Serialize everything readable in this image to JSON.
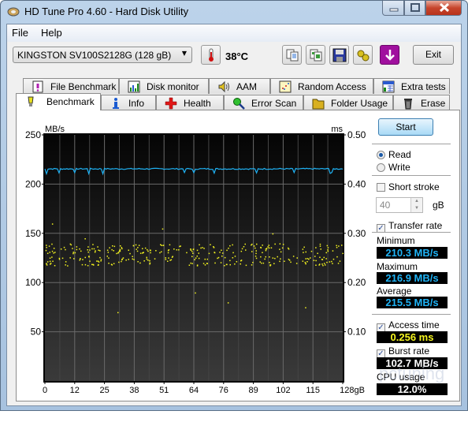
{
  "window": {
    "title": "HD Tune Pro 4.60 - Hard Disk Utility",
    "controls": {
      "minimize": "minimize-icon",
      "maximize": "maximize-icon",
      "close": "close-icon"
    }
  },
  "menu": [
    {
      "label": "File"
    },
    {
      "label": "Help"
    }
  ],
  "toolbar": {
    "drive": "KINGSTON SV100S2128G (128 gB)",
    "temperature": "38°C",
    "buttons": [
      "copy-text-icon",
      "copy-screenshot-icon",
      "save-icon",
      "options-icon",
      "download-icon"
    ],
    "exit_label": "Exit"
  },
  "tabs_top": [
    {
      "label": "File Benchmark",
      "icon": "file-benchmark-icon"
    },
    {
      "label": "Disk monitor",
      "icon": "disk-monitor-icon"
    },
    {
      "label": "AAM",
      "icon": "speaker-icon"
    },
    {
      "label": "Random Access",
      "icon": "random-access-icon"
    },
    {
      "label": "Extra tests",
      "icon": "extra-tests-icon"
    }
  ],
  "tabs_bottom": [
    {
      "label": "Benchmark",
      "icon": "lightbulb-icon",
      "active": true
    },
    {
      "label": "Info",
      "icon": "info-icon"
    },
    {
      "label": "Health",
      "icon": "health-cross-icon"
    },
    {
      "label": "Error Scan",
      "icon": "magnifier-icon"
    },
    {
      "label": "Folder Usage",
      "icon": "folder-icon"
    },
    {
      "label": "Erase",
      "icon": "trash-icon"
    }
  ],
  "side": {
    "start_label": "Start",
    "read_label": "Read",
    "write_label": "Write",
    "mode": "Read",
    "short_stroke_label": "Short stroke",
    "short_stroke_checked": false,
    "short_stroke_value": "40",
    "short_stroke_unit": "gB",
    "transfer_rate_label": "Transfer rate",
    "transfer_rate_checked": true,
    "minimum_label": "Minimum",
    "minimum": "210.3 MB/s",
    "maximum_label": "Maximum",
    "maximum": "216.9 MB/s",
    "average_label": "Average",
    "average": "215.5 MB/s",
    "access_time_label": "Access time",
    "access_time_checked": true,
    "access_time": "0.256 ms",
    "burst_rate_label": "Burst rate",
    "burst_rate_checked": true,
    "burst_rate": "102.7 MB/s",
    "cpu_label": "CPU usage",
    "cpu": "12.0%",
    "colors": {
      "transfer": "#1fb3f5",
      "access": "#f5f51f",
      "cpu": "#ffffff"
    }
  },
  "watermark": "pctuning",
  "chart_data": {
    "type": "line",
    "title": "",
    "ylabel_left": "MB/s",
    "ylabel_right": "ms",
    "xlabel_unit": "gB",
    "ylim_left": [
      0,
      250
    ],
    "ylim_right": [
      0,
      0.5
    ],
    "xlim": [
      0,
      128
    ],
    "yticks_left": [
      "250",
      "200",
      "150",
      "100",
      "50"
    ],
    "yticks_right": [
      "0.50",
      "0.40",
      "0.30",
      "0.20",
      "0.10"
    ],
    "xticks": [
      "0",
      "12",
      "25",
      "38",
      "51",
      "64",
      "76",
      "89",
      "102",
      "115",
      "128gB"
    ],
    "grid": true,
    "series": [
      {
        "name": "Transfer rate (MB/s)",
        "type": "line",
        "color": "#1fb3f5",
        "typical": 215.5,
        "min": 210.3,
        "max": 216.9,
        "dips_at_gB": [
          0.5,
          6,
          13,
          19,
          25,
          60,
          64,
          73,
          91,
          107,
          123
        ]
      },
      {
        "name": "Access time (ms)",
        "type": "scatter",
        "color": "#f5f51f",
        "bands_ms": [
          0.27,
          0.245
        ],
        "outliers_ms": [
          0.32,
          0.31,
          0.3,
          0.29,
          0.18,
          0.15,
          0.14,
          0.16
        ]
      }
    ]
  }
}
